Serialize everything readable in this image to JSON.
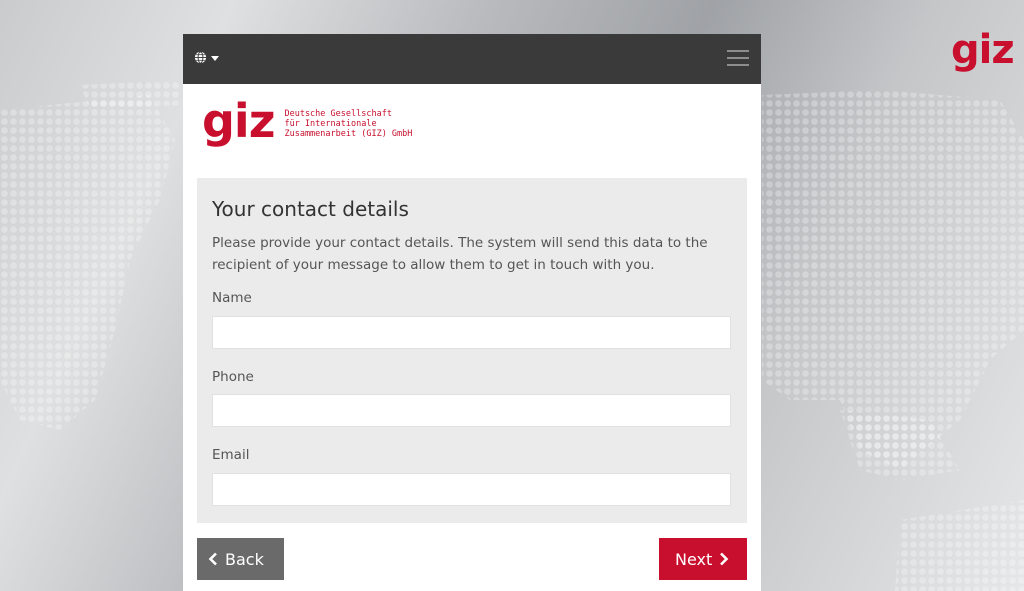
{
  "background": {
    "brand_text": "giz"
  },
  "topbar": {
    "language_icon": "globe-icon",
    "dropdown_icon": "caret-down-icon",
    "menu_icon": "hamburger-menu-icon"
  },
  "logo": {
    "mark": "giz",
    "org_line1": "Deutsche Gesellschaft",
    "org_line2": "für Internationale",
    "org_line3": "Zusammenarbeit (GIZ) GmbH"
  },
  "form": {
    "title": "Your contact details",
    "description": "Please provide your contact details. The system will send this data to the recipient of your message to allow them to get in touch with you.",
    "fields": [
      {
        "label": "Name",
        "value": ""
      },
      {
        "label": "Phone",
        "value": ""
      },
      {
        "label": "Email",
        "value": ""
      }
    ]
  },
  "buttons": {
    "back_label": "Back",
    "back_icon": "chevron-left-icon",
    "next_label": "Next",
    "next_icon": "chevron-right-icon"
  },
  "colors": {
    "brand_red": "#c8102e",
    "topbar": "#3a3a3a",
    "back_button": "#6a6a6a",
    "form_card": "#ebebeb"
  }
}
